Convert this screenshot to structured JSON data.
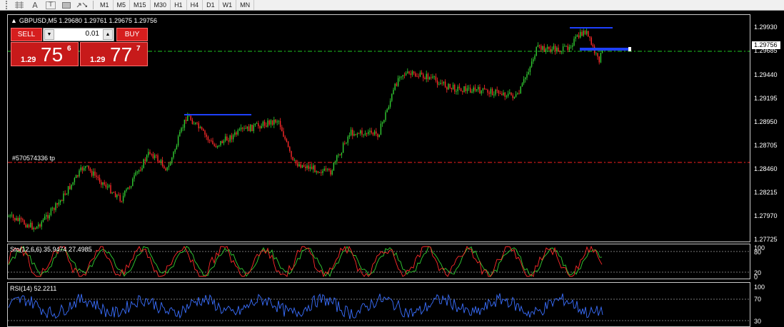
{
  "toolbar": {
    "icons": [
      "grip-icon",
      "grid-icon",
      "text-icon",
      "text-label-icon",
      "rectangle-icon",
      "arrows-icon"
    ],
    "text_icon_label": "A",
    "text_label_icon_label": "T",
    "timeframes": [
      "M1",
      "M5",
      "M15",
      "M30",
      "H1",
      "H4",
      "D1",
      "W1",
      "MN"
    ]
  },
  "chart": {
    "title": "GBPUSD,M5  1.29680 1.29761 1.29675 1.29756",
    "background": "#000000",
    "bull_color": "#32cd32",
    "bear_color": "#ff2a2a",
    "price_axis": [
      "1.29930",
      "1.29685",
      "1.29440",
      "1.29195",
      "1.28950",
      "1.28705",
      "1.28460",
      "1.28215",
      "1.27970",
      "1.27725"
    ],
    "current_price": "1.29756",
    "order_line_label": "#570574336 tp",
    "order_line_color": "#ff2020",
    "levels": [
      {
        "name": "left-resistance",
        "color": "#1e40ff"
      },
      {
        "name": "right-resistance",
        "color": "#1e40ff"
      },
      {
        "name": "current-bid",
        "color": "#22cc22"
      }
    ]
  },
  "trade_panel": {
    "sell_label": "SELL",
    "buy_label": "BUY",
    "lot_value": "0.01",
    "sell_price": {
      "prefix": "1.29",
      "big": "75",
      "pip": "6"
    },
    "buy_price": {
      "prefix": "1.29",
      "big": "77",
      "pip": "7"
    },
    "button_color": "#d61e1e"
  },
  "stoch": {
    "label": "Sto(12,6,6) 35.9474 27.4985",
    "axis": [
      "100",
      "80",
      "20",
      "0"
    ],
    "main_color": "#ff2a2a",
    "signal_color": "#32cd32"
  },
  "rsi": {
    "label": "RSI(14) 52.2211",
    "axis": [
      "100",
      "70",
      "30"
    ],
    "line_color": "#3a6fff"
  }
}
